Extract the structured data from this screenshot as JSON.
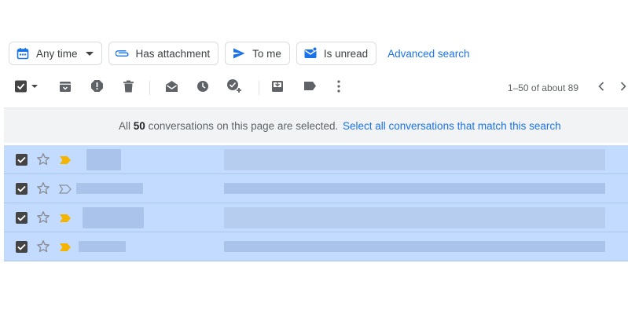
{
  "filters": {
    "any_time": "Any time",
    "has_attachment": "Has attachment",
    "to_me": "To me",
    "is_unread": "Is unread",
    "advanced_search": "Advanced search"
  },
  "pagination": {
    "range_text": "1–50 of about 89"
  },
  "banner": {
    "prefix": "All",
    "count": "50",
    "suffix": "conversations on this page are selected.",
    "select_all_link": "Select all conversations that match this search"
  },
  "colors": {
    "accent": "#1a73e8",
    "selected_row": "#c2dbff",
    "important_marker": "#f5b400",
    "banner_bg": "#f1f3f4"
  },
  "toolbar_icons": [
    "select-all-checkbox-icon",
    "archive-icon",
    "report-spam-icon",
    "delete-icon",
    "mark-as-read-icon",
    "snooze-icon",
    "add-to-tasks-icon",
    "move-to-inbox-icon",
    "label-icon",
    "more-vert-icon",
    "chevron-left-icon",
    "chevron-right-icon"
  ],
  "rows": [
    {
      "selected": true,
      "starred": false,
      "important": true
    },
    {
      "selected": true,
      "starred": false,
      "important": false
    },
    {
      "selected": true,
      "starred": false,
      "important": true
    },
    {
      "selected": true,
      "starred": false,
      "important": true
    }
  ]
}
